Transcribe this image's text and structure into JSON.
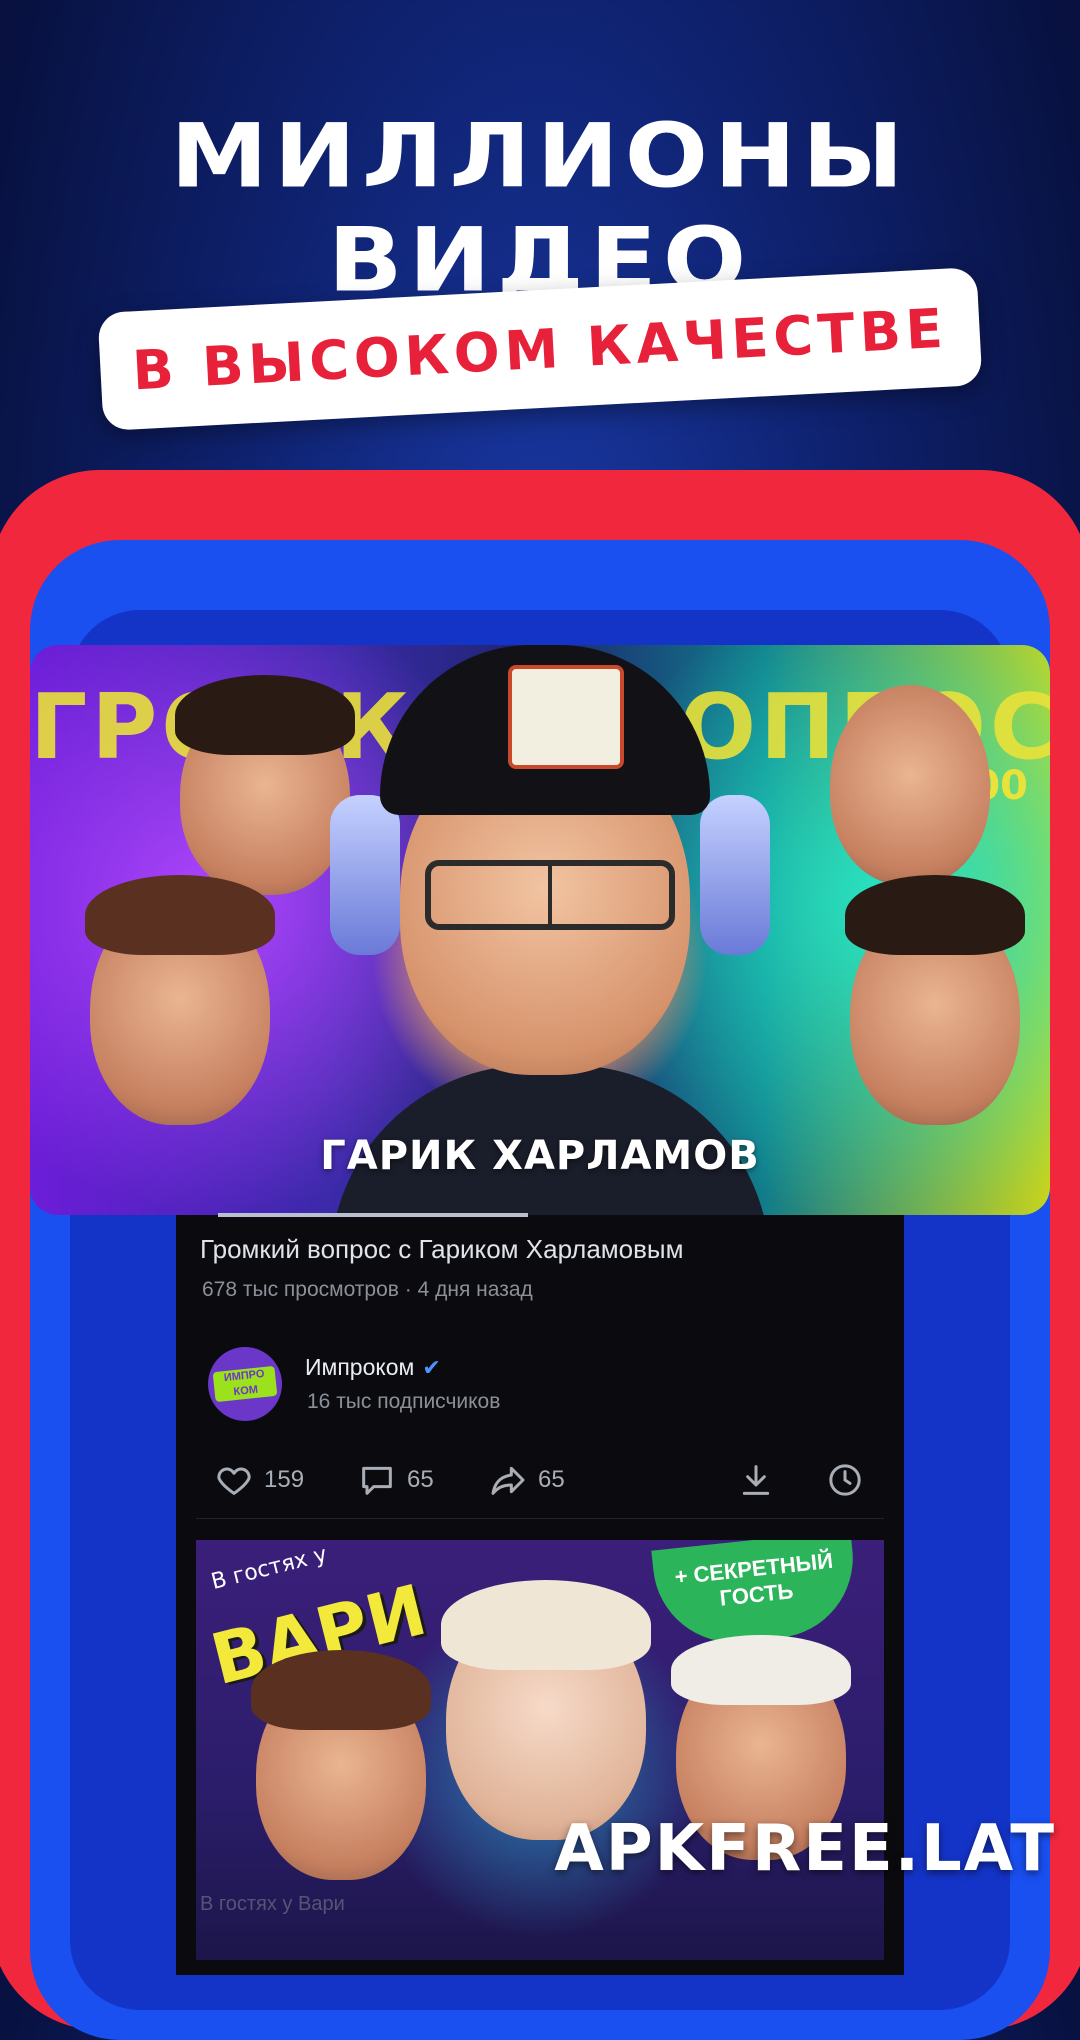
{
  "headline": {
    "line1": "МИЛЛИОНЫ",
    "line2": "ВИДЕО",
    "badge": "В ВЫСОКОМ КАЧЕСТВЕ"
  },
  "video": {
    "thumbnail_banner": "ГРОМКИЙ ВОПРОС",
    "thumbnail_price": "₽100",
    "thumbnail_caption": "ГАРИК ХАРЛАМОВ",
    "playback_progress": 0.45,
    "title": "Громкий вопрос с Гариком Харламовым",
    "meta": "678 тыс просмотров · 4 дня назад",
    "channel": {
      "name": "Импроком",
      "subscribers": "16 тыс подписчиков",
      "logo_text": "ИМПРО КОМ",
      "verified": true
    },
    "actions": {
      "likes": "159",
      "comments": "65",
      "shares": "65"
    }
  },
  "next_video": {
    "sticker_small": "В гостях у",
    "sticker_big": "ВАРИ",
    "sticker_secret": "+ СЕКРЕТНЫЙ ГОСТЬ",
    "title_peek": "В гостях у Вари"
  },
  "watermark": "APKFREE.LAT",
  "colors": {
    "background": "#0f2270",
    "accent_red": "#f1283d",
    "accent_blue": "#1a4ff0",
    "app_bg": "#0b0b0f",
    "verified": "#4b94ff"
  }
}
